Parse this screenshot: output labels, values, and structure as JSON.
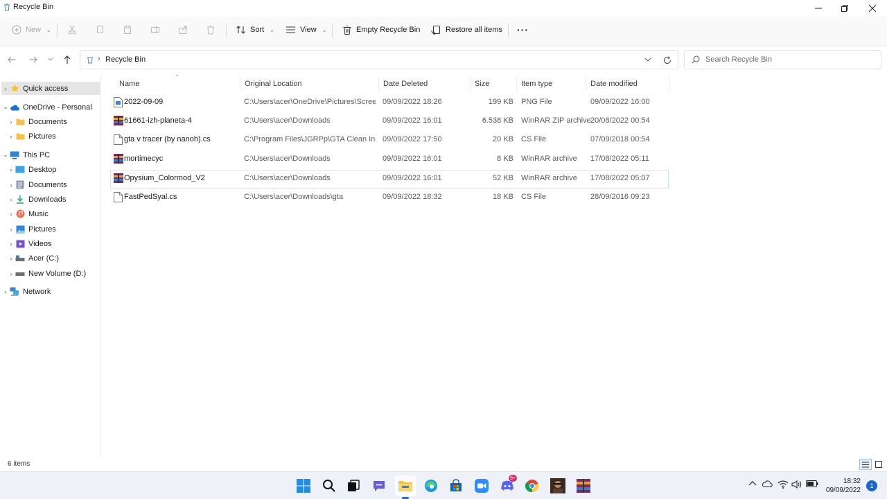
{
  "window": {
    "title": "Recycle Bin"
  },
  "toolbar": {
    "new_label": "New",
    "sort_label": "Sort",
    "view_label": "View",
    "empty_label": "Empty Recycle Bin",
    "restore_label": "Restore all items",
    "more_label": "···"
  },
  "address": {
    "path": "Recycle Bin",
    "search_placeholder": "Search Recycle Bin"
  },
  "sidebar": {
    "items": [
      {
        "label": "Quick access",
        "icon": "star-icon"
      },
      {
        "label": "OneDrive - Personal",
        "icon": "cloud-icon"
      },
      {
        "label": "Documents",
        "icon": "folder-icon"
      },
      {
        "label": "Pictures",
        "icon": "folder-icon"
      },
      {
        "label": "This PC",
        "icon": "computer-icon"
      },
      {
        "label": "Desktop",
        "icon": "desktop-icon"
      },
      {
        "label": "Documents",
        "icon": "documents-icon"
      },
      {
        "label": "Downloads",
        "icon": "download-icon"
      },
      {
        "label": "Music",
        "icon": "music-icon"
      },
      {
        "label": "Pictures",
        "icon": "pictures-icon"
      },
      {
        "label": "Videos",
        "icon": "videos-icon"
      },
      {
        "label": "Acer (C:)",
        "icon": "drive-icon"
      },
      {
        "label": "New Volume (D:)",
        "icon": "drive-icon"
      },
      {
        "label": "Network",
        "icon": "network-icon"
      }
    ]
  },
  "columns": {
    "name": "Name",
    "location": "Original Location",
    "deleted": "Date Deleted",
    "size": "Size",
    "type": "Item type",
    "modified": "Date modified"
  },
  "files": [
    {
      "name": "2022-09-09",
      "location": "C:\\Users\\acer\\OneDrive\\Pictures\\Screens...",
      "deleted": "09/09/2022 18:26",
      "size": "199 KB",
      "type": "PNG File",
      "modified": "09/09/2022 16:00",
      "icon": "image-file-icon"
    },
    {
      "name": "61661-izh-planeta-4",
      "location": "C:\\Users\\acer\\Downloads",
      "deleted": "09/09/2022 16:01",
      "size": "6.538 KB",
      "type": "WinRAR ZIP archive",
      "modified": "20/08/2022 00:54",
      "icon": "winrar-icon"
    },
    {
      "name": "gta v tracer (by nanoh).cs",
      "location": "C:\\Program Files\\JGRPp\\GTA Clean Indon...",
      "deleted": "09/09/2022 17:50",
      "size": "20 KB",
      "type": "CS File",
      "modified": "07/09/2018 00:54",
      "icon": "text-file-icon"
    },
    {
      "name": "mortimecyc",
      "location": "C:\\Users\\acer\\Downloads",
      "deleted": "09/09/2022 16:01",
      "size": "8 KB",
      "type": "WinRAR archive",
      "modified": "17/08/2022 05:11",
      "icon": "winrar-icon"
    },
    {
      "name": "Opysium_Colormod_V2",
      "location": "C:\\Users\\acer\\Downloads",
      "deleted": "09/09/2022 16:01",
      "size": "52 KB",
      "type": "WinRAR archive",
      "modified": "17/08/2022 05:07",
      "icon": "winrar-icon"
    },
    {
      "name": "FastPedSyal.cs",
      "location": "C:\\Users\\acer\\Downloads\\gta",
      "deleted": "09/09/2022 18:32",
      "size": "18 KB",
      "type": "CS File",
      "modified": "28/09/2016 09:23",
      "icon": "text-file-icon"
    }
  ],
  "status": {
    "count": "6 items"
  },
  "taskbar": {
    "time": "18:32",
    "date": "09/09/2022",
    "notification_count": "1",
    "discord_badge": "9+"
  },
  "colors": {
    "accent": "#1a73c7",
    "folder": "#f3c04e",
    "selection": "#e5e5e5"
  }
}
